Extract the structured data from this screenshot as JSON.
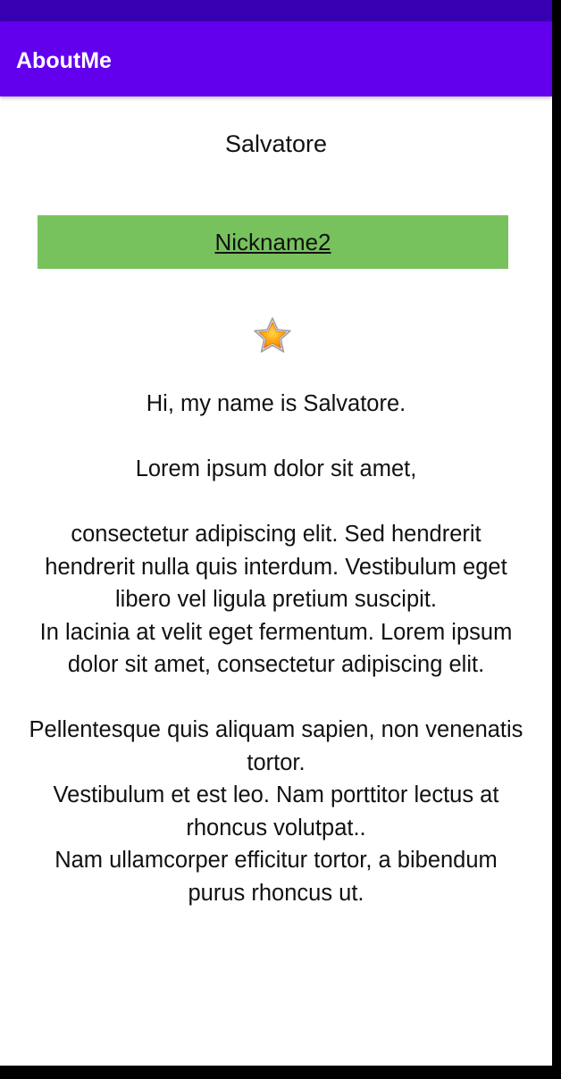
{
  "app": {
    "title": "AboutMe"
  },
  "profile": {
    "name": "Salvatore",
    "nickname": "Nickname2",
    "bio": "Hi, my name is Salvatore.\n\nLorem ipsum dolor sit amet,\n\nconsectetur adipiscing elit. Sed hendrerit hendrerit nulla quis interdum. Vestibulum eget libero vel ligula pretium suscipit.\nIn lacinia at velit eget fermentum. Lorem ipsum dolor sit amet, consectetur adipiscing elit.\n\nPellentesque quis aliquam sapien, non venenatis tortor.\nVestibulum et est leo. Nam porttitor lectus at rhoncus volutpat..\nNam ullamcorper efficitur tortor, a bibendum purus rhoncus ut."
  },
  "icons": {
    "star": "star-icon"
  },
  "colors": {
    "status_bar": "#3700B3",
    "app_bar": "#6200EE",
    "nickname_background": "#78C25E"
  }
}
